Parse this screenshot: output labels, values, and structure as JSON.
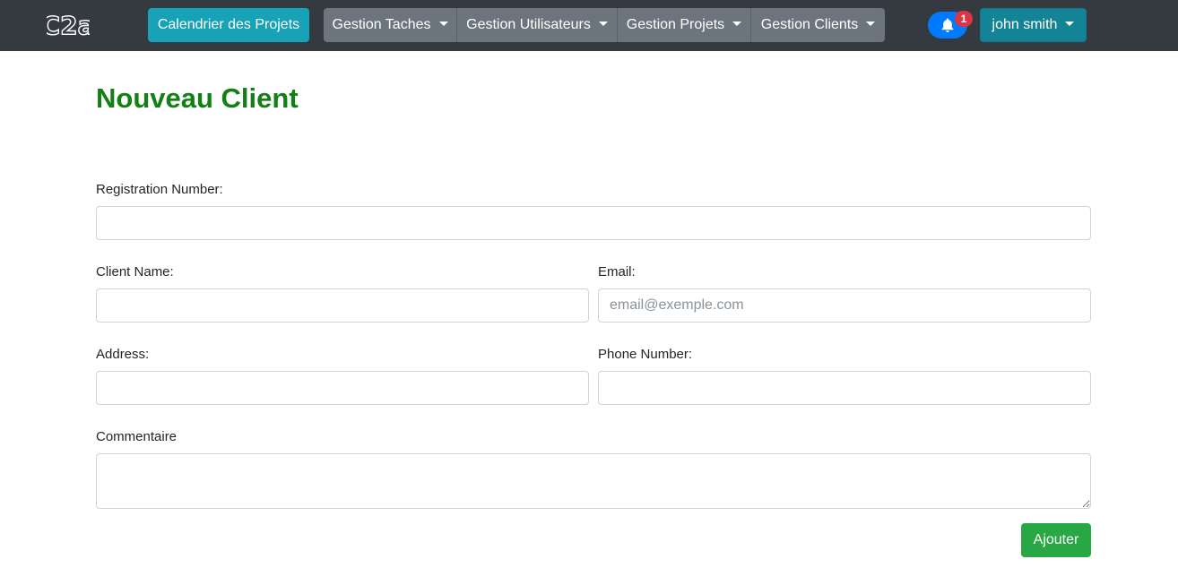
{
  "navbar": {
    "logo_text": "C2a",
    "calendar_button": "Calendrier des Projets",
    "menus": [
      {
        "label": "Gestion Taches"
      },
      {
        "label": "Gestion Utilisateurs"
      },
      {
        "label": "Gestion Projets"
      },
      {
        "label": "Gestion Clients"
      }
    ],
    "notification_count": "1",
    "user_name": "john smith"
  },
  "page": {
    "title": "Nouveau Client"
  },
  "form": {
    "registration_label": "Registration Number:",
    "registration_value": "",
    "client_name_label": "Client Name:",
    "client_name_value": "",
    "email_label": "Email:",
    "email_placeholder": "email@exemple.com",
    "address_label": "Address:",
    "address_value": "",
    "phone_label": "Phone Number:",
    "phone_value": "",
    "comment_label": "Commentaire",
    "comment_value": "",
    "submit_label": "Ajouter"
  },
  "colors": {
    "navbar_bg": "#343a40",
    "calendar_btn": "#17a2b8",
    "menu_group": "#6c757d",
    "notification_btn": "#007bff",
    "badge": "#dc3545",
    "user_btn": "#138496",
    "title": "#138016",
    "submit_btn": "#28a745"
  }
}
